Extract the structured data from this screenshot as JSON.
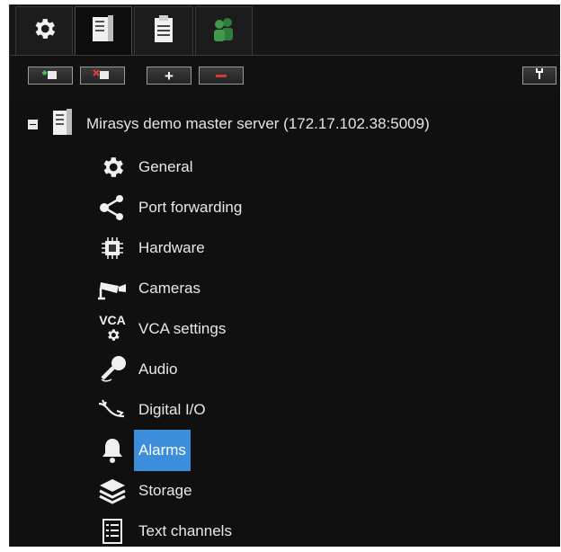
{
  "tabs": [
    {
      "icon": "gear-icon",
      "active": false
    },
    {
      "icon": "server-icon",
      "active": true
    },
    {
      "icon": "clipboard-icon",
      "active": false
    },
    {
      "icon": "users-icon",
      "active": false
    }
  ],
  "toolbar": {
    "add_server": {
      "icon": "server-add-icon"
    },
    "remove_server": {
      "icon": "server-remove-icon"
    },
    "expand": {
      "label": "+"
    },
    "collapse": {
      "label": "−"
    },
    "tools": {
      "icon": "tools-icon"
    }
  },
  "tree": {
    "root": {
      "label": "Mirasys demo master server (172.17.102.38:5009)",
      "expanded": true
    },
    "items": [
      {
        "label": "General",
        "icon": "gear-icon"
      },
      {
        "label": "Port forwarding",
        "icon": "share-icon"
      },
      {
        "label": "Hardware",
        "icon": "chip-icon"
      },
      {
        "label": "Cameras",
        "icon": "camera-icon"
      },
      {
        "label": "VCA settings",
        "icon": "vca-icon",
        "icon_text": "VCA"
      },
      {
        "label": "Audio",
        "icon": "microphone-icon"
      },
      {
        "label": "Digital I/O",
        "icon": "digital-io-icon"
      },
      {
        "label": "Alarms",
        "icon": "bell-icon",
        "selected": true
      },
      {
        "label": "Storage",
        "icon": "layers-icon"
      },
      {
        "label": "Text channels",
        "icon": "list-icon"
      }
    ]
  },
  "colors": {
    "panel_bg": "#101010",
    "selection": "#3c8edb",
    "text": "#e8e8e8"
  }
}
